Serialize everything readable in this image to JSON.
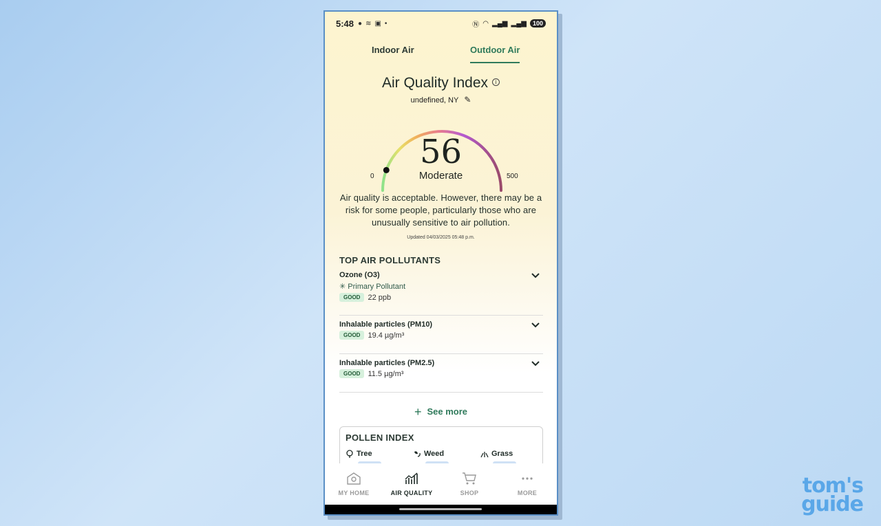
{
  "status_bar": {
    "time": "5:48",
    "battery": "100"
  },
  "tabs": [
    {
      "label": "Indoor Air"
    },
    {
      "label": "Outdoor Air"
    }
  ],
  "title": "Air Quality Index",
  "location": "undefined, NY",
  "gauge": {
    "value": "56",
    "label": "Moderate",
    "min": "0",
    "max": "500",
    "fraction": 0.112
  },
  "description": "Air quality is acceptable. However, there may be a risk for some people, particularly those who are unusually sensitive to air pollution.",
  "updated": "Updated 04/03/2025 05:48 p.m.",
  "pollutants": {
    "title": "TOP AIR POLLUTANTS",
    "items": [
      {
        "name": "Ozone (O3)",
        "sub": "✳ Primary Pollutant",
        "badge": "GOOD",
        "value": "22 ppb"
      },
      {
        "name": "Inhalable particles (PM10)",
        "badge": "GOOD",
        "value": "19.4 µg/m³"
      },
      {
        "name": "Inhalable particles (PM2.5)",
        "badge": "GOOD",
        "value": "11.5 µg/m³"
      }
    ]
  },
  "see_more": "See more",
  "pollen": {
    "title": "POLLEN INDEX",
    "items": [
      {
        "label": "Tree"
      },
      {
        "label": "Weed"
      },
      {
        "label": "Grass"
      }
    ]
  },
  "nav": [
    {
      "label": "MY HOME"
    },
    {
      "label": "AIR QUALITY"
    },
    {
      "label": "SHOP"
    },
    {
      "label": "MORE"
    }
  ],
  "watermark": {
    "line1": "tom's",
    "line2": "guide"
  },
  "colors": {
    "accent": "#2f7a5b",
    "badge_good": "#d6f0dc"
  }
}
